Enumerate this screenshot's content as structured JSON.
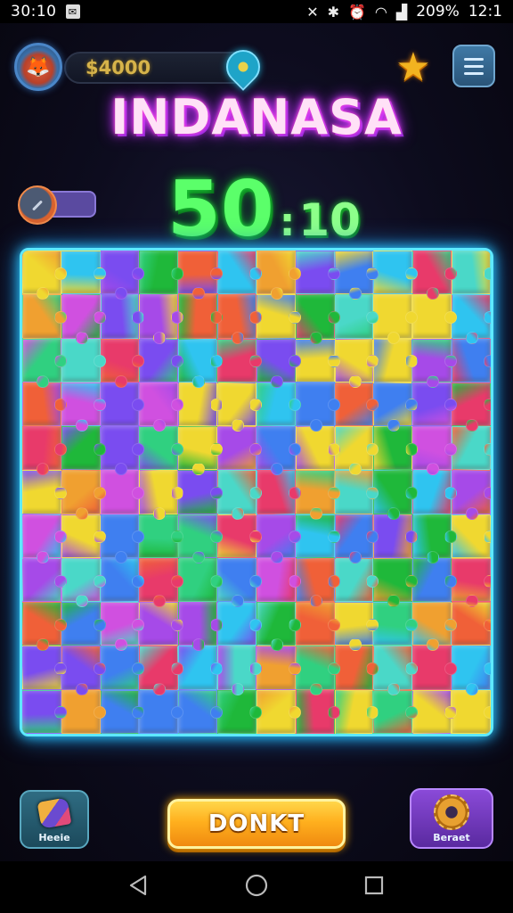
{
  "status_bar": {
    "time": "30:10",
    "battery": "209%",
    "clock_right": "12:1",
    "icons": [
      "notification-icon",
      "mute-icon",
      "bluetooth-icon",
      "alarm-icon",
      "wifi-icon",
      "signal-icon"
    ]
  },
  "header": {
    "coins": "$4000",
    "avatar_icon": "fox-avatar-icon",
    "pin_icon": "map-pin-icon",
    "star_icon": "star-icon",
    "menu_icon": "hamburger-menu-icon"
  },
  "title": "INDANASA",
  "timer": {
    "major": "50",
    "separator": ":",
    "minor": "10"
  },
  "board": {
    "columns": 12,
    "rows": 11,
    "palette": [
      "#7a4cf0",
      "#3f7ff0",
      "#2fc4f0",
      "#30d080",
      "#1fb83a",
      "#f0d830",
      "#f0a030",
      "#f06038",
      "#e83a6a",
      "#d050e0",
      "#a64ae8",
      "#4ad8c8"
    ]
  },
  "buttons": {
    "left_label": "Heeie",
    "main_label": "DONKT",
    "right_label": "Beraet"
  },
  "colors": {
    "board_glow": "#5ee9ff",
    "title_glow": "#d23bff",
    "timer_green": "#5bff6a",
    "coin_gold": "#d6b34a"
  }
}
